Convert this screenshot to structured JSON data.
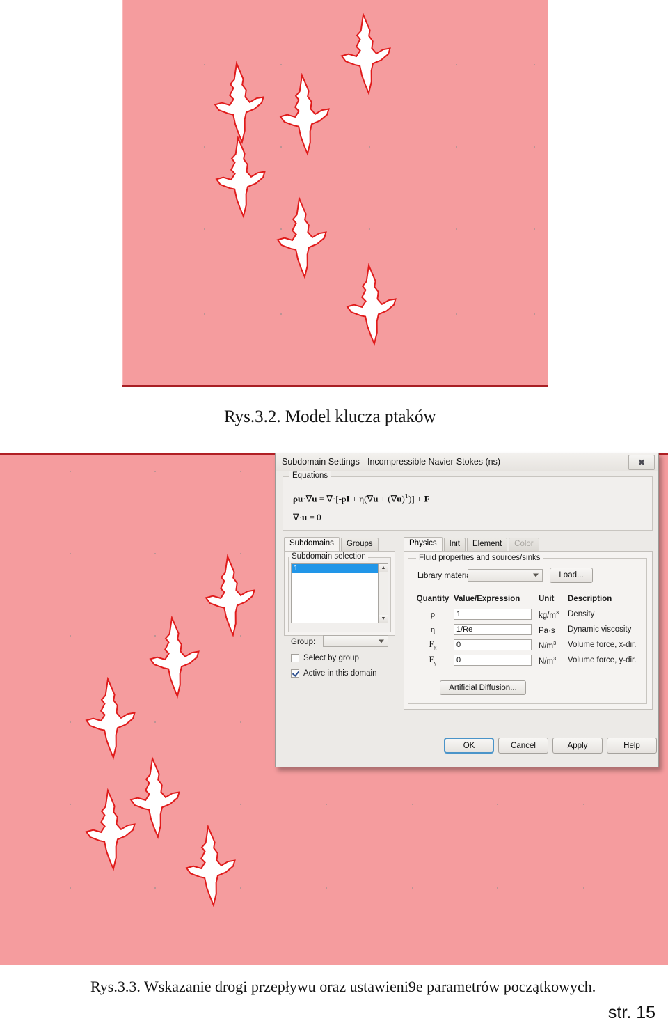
{
  "figure_top": {
    "caption": "Rys.3.2. Model klucza ptaków",
    "background_color": "#f59c9e",
    "bird_fill": "#ffffff",
    "bird_outline": "#e01b1b"
  },
  "figure_bottom": {
    "caption": "Rys.3.3. Wskazanie drogi przepływu oraz ustawieni9e parametrów początkowych.",
    "background_color": "#f59c9e"
  },
  "page": {
    "footer": "str. 15"
  },
  "dialog": {
    "title": "Subdomain Settings - Incompressible Navier-Stokes (ns)",
    "close_icon": "close-icon",
    "equations": {
      "legend": "Equations",
      "line1": "ρu·∇u = ∇·[-pI + η(∇u + (∇u)T)] + F",
      "line2": "∇·u = 0"
    },
    "left_tabs": [
      {
        "label": "Subdomains",
        "active": true,
        "disabled": false
      },
      {
        "label": "Groups",
        "active": false,
        "disabled": false
      }
    ],
    "subdomain": {
      "legend": "Subdomain selection",
      "list_items": [
        "1"
      ],
      "selected": "1",
      "group_label": "Group:",
      "group_value": "",
      "select_by_group_label": "Select by group",
      "select_by_group_checked": false,
      "active_in_domain_label": "Active in this domain",
      "active_in_domain_checked": true
    },
    "right_tabs": [
      {
        "label": "Physics",
        "active": true,
        "disabled": false
      },
      {
        "label": "Init",
        "active": false,
        "disabled": false
      },
      {
        "label": "Element",
        "active": false,
        "disabled": false
      },
      {
        "label": "Color",
        "active": false,
        "disabled": true
      }
    ],
    "physics": {
      "legend": "Fluid properties and sources/sinks",
      "library_material_label": "Library material:",
      "library_material_value": "",
      "load_button": "Load...",
      "table_headers": {
        "quantity": "Quantity",
        "value": "Value/Expression",
        "unit": "Unit",
        "description": "Description"
      },
      "rows": [
        {
          "quantity": "ρ",
          "sub": "",
          "value": "1",
          "unit": "kg/m",
          "unit_sup": "3",
          "description": "Density"
        },
        {
          "quantity": "η",
          "sub": "",
          "value": "1/Re",
          "unit": "Pa·s",
          "unit_sup": "",
          "description": "Dynamic viscosity"
        },
        {
          "quantity": "F",
          "sub": "x",
          "value": "0",
          "unit": "N/m",
          "unit_sup": "3",
          "description": "Volume force, x-dir."
        },
        {
          "quantity": "F",
          "sub": "y",
          "value": "0",
          "unit": "N/m",
          "unit_sup": "3",
          "description": "Volume force, y-dir."
        }
      ],
      "artificial_diffusion_button": "Artificial Diffusion..."
    },
    "buttons": {
      "ok": "OK",
      "cancel": "Cancel",
      "apply": "Apply",
      "help": "Help"
    }
  }
}
